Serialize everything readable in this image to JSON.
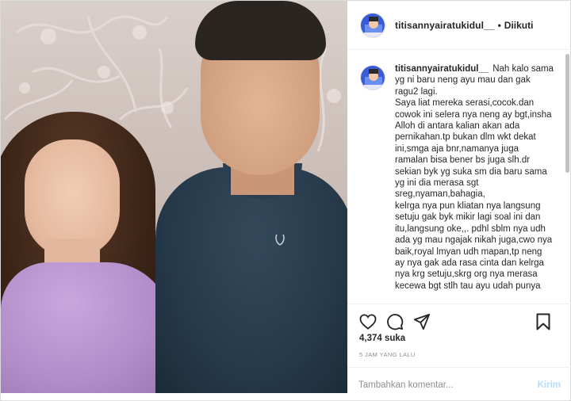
{
  "header": {
    "username": "titisannyairatukidul__",
    "separator": "•",
    "follow_status": "Diikuti"
  },
  "caption": {
    "username": "titisannyairatukidul__",
    "first_line_text": "Nah kalo sama",
    "lines": [
      "yg ni baru neng ayu mau dan gak",
      "ragu2 lagi.",
      "Saya liat mereka serasi,cocok.dan",
      "cowok ini selera nya neng ay bgt,insha",
      "Alloh di antara kalian akan ada",
      "pernikahan.tp bukan dlm wkt dekat",
      "ini,smga aja bnr,namanya juga",
      "ramalan bisa bener bs juga slh.dr",
      "sekian byk yg suka sm dia baru sama",
      "yg ini dia merasa sgt",
      "sreg,nyaman,bahagia,",
      "kelrga nya pun kliatan nya langsung",
      "setuju gak byk mikir lagi soal ini dan",
      "itu,langsung oke,,. pdhl sblm nya udh",
      "ada yg mau ngajak nikah juga,cwo nya",
      "baik,royal lmyan udh mapan,tp neng",
      "ay nya gak ada rasa cinta dan kelrga",
      "nya krg setuju,skrg org nya merasa",
      "kecewa bgt stlh tau ayu udah punya"
    ]
  },
  "icons": {
    "like": "heart-icon",
    "comment": "comment-icon",
    "share": "share-icon",
    "save": "bookmark-icon"
  },
  "stats": {
    "likes": "4,374 suka",
    "timestamp": "5 JAM YANG LALU"
  },
  "comment": {
    "placeholder": "Tambahkan komentar...",
    "post_label": "Kirim"
  },
  "colors": {
    "post_button_disabled": "#b3dbff",
    "muted_text": "#8e8e8e",
    "border": "#dbdbdb"
  }
}
